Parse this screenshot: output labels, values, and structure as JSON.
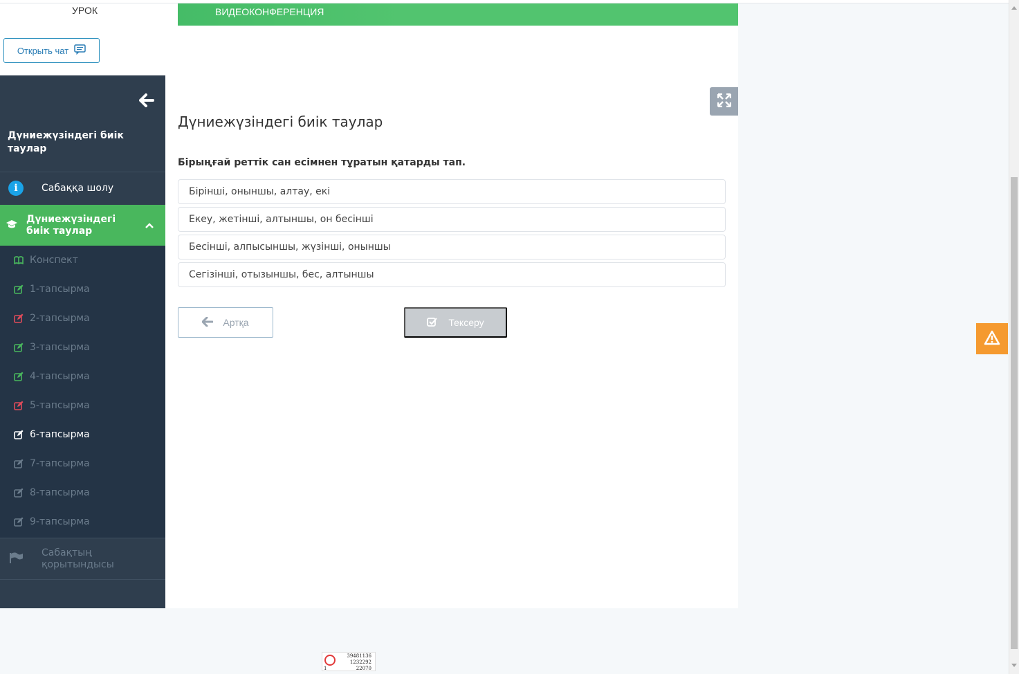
{
  "header": {
    "tab_lesson": "УРОК",
    "chat_button": "Открыть чат",
    "video_bar": "ВИДЕОКОНФЕРЕНЦИЯ"
  },
  "sidebar": {
    "lesson_title": "Дүниежүзіндегі биік таулар",
    "overview_label": "Сабаққа шолу",
    "active_section": "Дүниежүзіндегі биік таулар",
    "items": [
      {
        "label": "Конспект",
        "icon": "book-icon",
        "color": "#49b75d"
      },
      {
        "label": "1-тапсырма",
        "icon": "edit-icon",
        "color": "#49b75d"
      },
      {
        "label": "2-тапсырма",
        "icon": "edit-icon",
        "color": "#e04b5a"
      },
      {
        "label": "3-тапсырма",
        "icon": "edit-icon",
        "color": "#49b75d"
      },
      {
        "label": "4-тапсырма",
        "icon": "edit-icon",
        "color": "#49b75d"
      },
      {
        "label": "5-тапсырма",
        "icon": "edit-icon",
        "color": "#e04b5a"
      },
      {
        "label": "6-тапсырма",
        "icon": "edit-icon",
        "color": "#ffffff"
      },
      {
        "label": "7-тапсырма",
        "icon": "edit-icon",
        "color": "#6b7c8c"
      },
      {
        "label": "8-тапсырма",
        "icon": "edit-icon",
        "color": "#6b7c8c"
      },
      {
        "label": "9-тапсырма",
        "icon": "edit-icon",
        "color": "#6b7c8c"
      }
    ],
    "summary_label": "Сабақтың қорытындысы"
  },
  "main": {
    "title": "Дүниежүзіндегі биік таулар",
    "question": "Бірыңғай реттік сан есімнен тұратын қатарды тап.",
    "options": [
      "Бірінші, оныншы, алтау, екі",
      "Екеу, жетінші, алтыншы, он бесінші",
      "Бесінші, алпысыншы, жүзінші, оныншы",
      "Сегізінші, отызыншы, бес, алтыншы"
    ],
    "back_button": "Артқа",
    "check_button": "Тексеру"
  },
  "counter": {
    "line1": "39481136",
    "line2": "1232292",
    "line3": "22070",
    "line0": "1"
  },
  "colors": {
    "accent_green": "#49b75d",
    "sidebar_bg": "#2f3e4e",
    "warning": "#f59a2f"
  }
}
